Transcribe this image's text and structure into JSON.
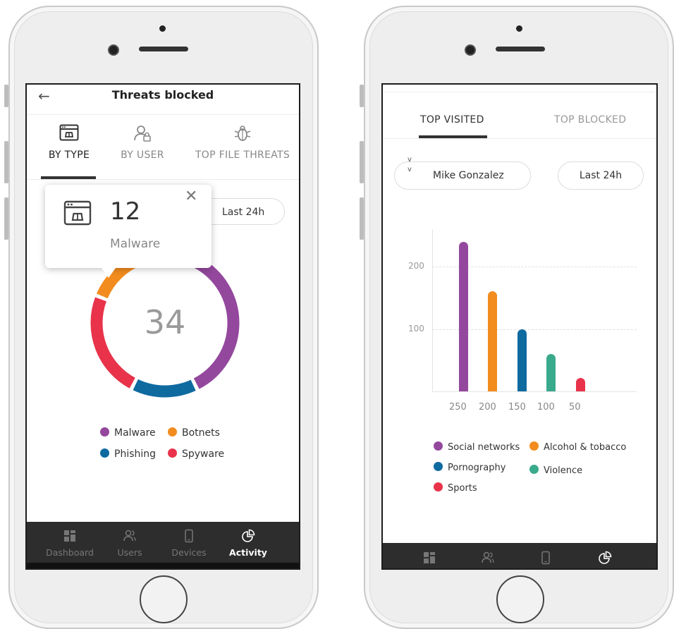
{
  "colors": {
    "malware": "#93489d",
    "botnets": "#f28c1e",
    "phishing": "#0f6aa0",
    "spyware": "#e8334a",
    "violence": "#3aaa8c",
    "navbar": "#2d2d2d"
  },
  "left_screen": {
    "header": {
      "back_icon": "back-arrow-icon",
      "title": "Threats blocked"
    },
    "tabs": [
      {
        "label": "BY TYPE",
        "icon": "browser-bug-icon",
        "active": true
      },
      {
        "label": "BY USER",
        "icon": "user-lock-icon",
        "active": false
      },
      {
        "label": "TOP FILE THREATS",
        "icon": "bug-icon",
        "active": false
      }
    ],
    "time_filter": "Last 24h",
    "tooltip": {
      "count": "12",
      "label": "Malware",
      "close_icon": "close-icon"
    },
    "donut": {
      "total": "34",
      "segments": [
        {
          "name": "Malware",
          "value": 12
        },
        {
          "name": "Phishing",
          "value": 5
        },
        {
          "name": "Spyware",
          "value": 8
        },
        {
          "name": "Botnets",
          "value": 9
        }
      ]
    },
    "legend": [
      "Malware",
      "Botnets",
      "Phishing",
      "Spyware"
    ],
    "nav": [
      {
        "label": "Dashboard",
        "icon": "dashboard-icon",
        "active": false
      },
      {
        "label": "Users",
        "icon": "users-icon",
        "active": false
      },
      {
        "label": "Devices",
        "icon": "device-icon",
        "active": false
      },
      {
        "label": "Activity",
        "icon": "pie-chart-icon",
        "active": true
      }
    ]
  },
  "right_screen": {
    "tabs": [
      {
        "label": "TOP VISITED",
        "active": true
      },
      {
        "label": "TOP BLOCKED",
        "active": false
      }
    ],
    "user_select": {
      "value": "Mike Gonzalez",
      "icon": "up-down-chevron-icon"
    },
    "time_filter": "Last 24h",
    "legend": [
      "Social networks",
      "Alcohol & tobacco",
      "Pornography",
      "Violence",
      "Sports"
    ],
    "nav_icons": [
      "dashboard-icon",
      "users-icon",
      "device-icon",
      "pie-chart-icon"
    ]
  },
  "chart_data": {
    "type": "bar",
    "categories": [
      "250",
      "200",
      "150",
      "100",
      "50"
    ],
    "series": [
      {
        "values": [
          240,
          160,
          100,
          60,
          22
        ]
      }
    ],
    "series_colors": [
      "#93489d",
      "#f28c1e",
      "#0f6aa0",
      "#3aaa8c",
      "#e8334a"
    ],
    "category_names": [
      "Social networks",
      "Alcohol & tobacco",
      "Pornography",
      "Violence",
      "Sports"
    ],
    "y_ticks": [
      "200",
      "100"
    ],
    "ylim": [
      0,
      260
    ],
    "grid": true
  }
}
